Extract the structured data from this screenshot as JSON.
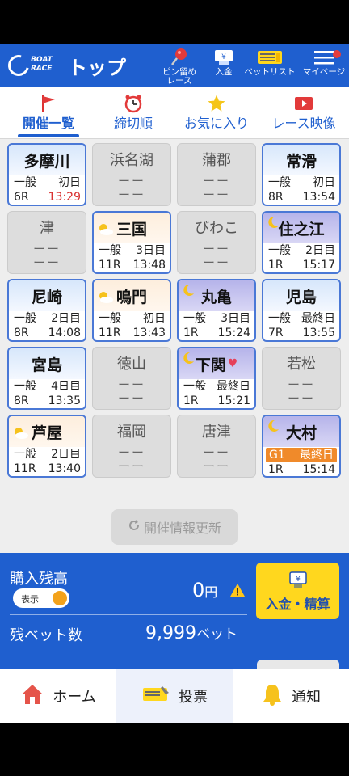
{
  "header": {
    "logo_line1": "BOAT",
    "logo_line2": "RACE",
    "title": "トップ",
    "buttons": [
      {
        "label": "ピン留め\nレース",
        "icon": "pin-icon"
      },
      {
        "label": "入金",
        "icon": "deposit-ticket-icon"
      },
      {
        "label": "ベットリスト",
        "icon": "betlist-icon"
      },
      {
        "label": "マイページ",
        "icon": "menu-icon"
      }
    ]
  },
  "tabs": [
    {
      "label": "開催一覧",
      "icon": "flag-icon",
      "active": true
    },
    {
      "label": "締切順",
      "icon": "alarm-clock-icon",
      "active": false
    },
    {
      "label": "お気に入り",
      "icon": "star-icon",
      "active": false
    },
    {
      "label": "レース映像",
      "icon": "video-play-icon",
      "active": false
    }
  ],
  "venues": [
    {
      "name": "多摩川",
      "active": true,
      "band": "day",
      "grade": "一般",
      "day": "初日",
      "race": "6R",
      "time": "13:29",
      "time_alert": true
    },
    {
      "name": "浜名湖",
      "active": false,
      "placeholder": "ーー"
    },
    {
      "name": "蒲郡",
      "active": false,
      "placeholder": "ーー"
    },
    {
      "name": "常滑",
      "active": true,
      "band": "day",
      "grade": "一般",
      "day": "初日",
      "race": "8R",
      "time": "13:54"
    },
    {
      "name": "津",
      "active": false,
      "placeholder": "ーー"
    },
    {
      "name": "三国",
      "active": true,
      "band": "eve",
      "grade": "一般",
      "day": "3日目",
      "race": "11R",
      "time": "13:48"
    },
    {
      "name": "びわこ",
      "active": false,
      "placeholder": "ーー"
    },
    {
      "name": "住之江",
      "active": true,
      "band": "night",
      "grade": "一般",
      "day": "2日目",
      "race": "1R",
      "time": "15:17"
    },
    {
      "name": "尼崎",
      "active": true,
      "band": "day",
      "grade": "一般",
      "day": "2日目",
      "race": "8R",
      "time": "14:08"
    },
    {
      "name": "鳴門",
      "active": true,
      "band": "eve",
      "grade": "一般",
      "day": "初日",
      "race": "11R",
      "time": "13:43"
    },
    {
      "name": "丸亀",
      "active": true,
      "band": "night",
      "grade": "一般",
      "day": "3日目",
      "race": "1R",
      "time": "15:24"
    },
    {
      "name": "児島",
      "active": true,
      "band": "day",
      "grade": "一般",
      "day": "最終日",
      "race": "7R",
      "time": "13:55"
    },
    {
      "name": "宮島",
      "active": true,
      "band": "day",
      "grade": "一般",
      "day": "4日目",
      "race": "8R",
      "time": "13:35"
    },
    {
      "name": "徳山",
      "active": false,
      "placeholder": "ーー"
    },
    {
      "name": "下関",
      "active": true,
      "band": "night",
      "favorite": true,
      "grade": "一般",
      "day": "最終日",
      "race": "1R",
      "time": "15:21"
    },
    {
      "name": "若松",
      "active": false,
      "placeholder": "ーー"
    },
    {
      "name": "芦屋",
      "active": true,
      "band": "eve",
      "grade": "一般",
      "day": "2日目",
      "race": "11R",
      "time": "13:40"
    },
    {
      "name": "福岡",
      "active": false,
      "placeholder": "ーー"
    },
    {
      "name": "唐津",
      "active": false,
      "placeholder": "ーー"
    },
    {
      "name": "大村",
      "active": true,
      "band": "night",
      "grade": "G1",
      "grade_highlight": true,
      "day": "最終日",
      "race": "1R",
      "time": "15:14"
    }
  ],
  "refresh_label": "開催情報更新",
  "balance": {
    "label": "購入残高",
    "toggle_label": "表示",
    "amount": "0",
    "amount_unit": "円",
    "bets_label": "残ベット数",
    "bets_value": "9,999",
    "bets_unit": "ベット",
    "deposit_label": "入金・精算"
  },
  "bottom_nav": [
    {
      "label": "ホーム",
      "icon": "home-icon"
    },
    {
      "label": "投票",
      "icon": "bet-ticket-icon"
    },
    {
      "label": "通知",
      "icon": "bell-icon"
    }
  ],
  "colors": {
    "brand_blue": "#1f5fcf",
    "accent_yellow": "#ffd71e",
    "alert_red": "#d93030",
    "grade_orange": "#f08a2a"
  }
}
